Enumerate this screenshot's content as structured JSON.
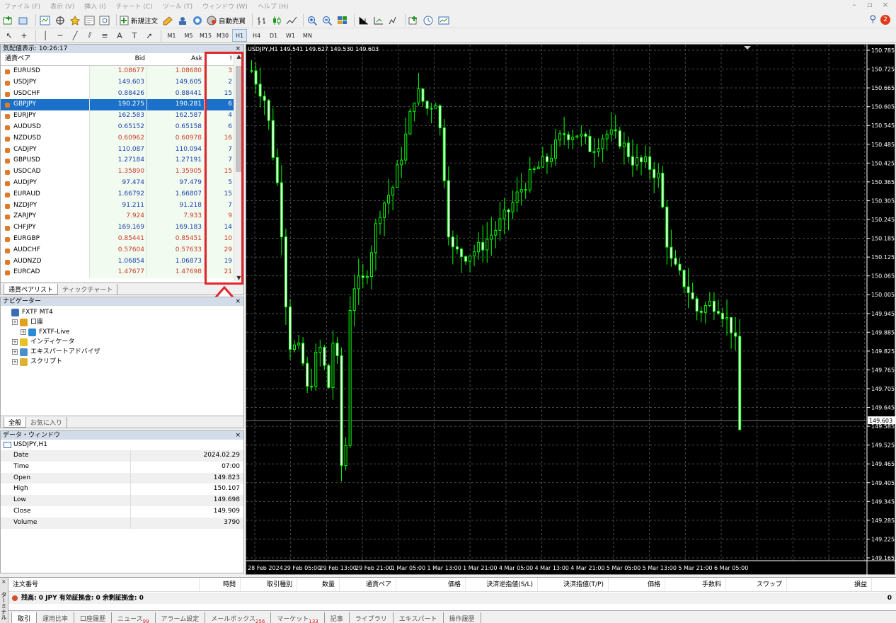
{
  "menu": [
    "ファイル (F)",
    "表示 (V)",
    "挿入 (I)",
    "チャート (C)",
    "ツール (T)",
    "ウィンドウ (W)",
    "ヘルプ (H)"
  ],
  "toolbar": {
    "new_order": "新規注文",
    "auto_trade": "自動売買",
    "notif_count": "2"
  },
  "timeframes": [
    "M1",
    "M5",
    "M15",
    "M30",
    "H1",
    "H4",
    "D1",
    "W1",
    "MN"
  ],
  "active_timeframe": "H1",
  "market_watch": {
    "title": "気配値表示: 10:26:17",
    "columns": [
      "通貨ペア",
      "Bid",
      "Ask",
      "!"
    ],
    "rows": [
      {
        "symbol": "EURUSD",
        "bid": "1.08677",
        "ask": "1.08680",
        "spread": "3",
        "color": "#d03a2a"
      },
      {
        "symbol": "USDJPY",
        "bid": "149.603",
        "ask": "149.605",
        "spread": "2",
        "color": "#1a3fb0"
      },
      {
        "symbol": "USDCHF",
        "bid": "0.88426",
        "ask": "0.88441",
        "spread": "15",
        "color": "#1a3fb0"
      },
      {
        "symbol": "GBPJPY",
        "bid": "190.275",
        "ask": "190.281",
        "spread": "6",
        "color": "#ffffff",
        "selected": true
      },
      {
        "symbol": "EURJPY",
        "bid": "162.583",
        "ask": "162.587",
        "spread": "4",
        "color": "#1a3fb0"
      },
      {
        "symbol": "AUDUSD",
        "bid": "0.65152",
        "ask": "0.65158",
        "spread": "6",
        "color": "#1a3fb0"
      },
      {
        "symbol": "NZDUSD",
        "bid": "0.60962",
        "ask": "0.60978",
        "spread": "16",
        "color": "#d03a2a"
      },
      {
        "symbol": "CADJPY",
        "bid": "110.087",
        "ask": "110.094",
        "spread": "7",
        "color": "#1a3fb0"
      },
      {
        "symbol": "GBPUSD",
        "bid": "1.27184",
        "ask": "1.27191",
        "spread": "7",
        "color": "#1a3fb0"
      },
      {
        "symbol": "USDCAD",
        "bid": "1.35890",
        "ask": "1.35905",
        "spread": "15",
        "color": "#d03a2a"
      },
      {
        "symbol": "AUDJPY",
        "bid": "97.474",
        "ask": "97.479",
        "spread": "5",
        "color": "#1a3fb0"
      },
      {
        "symbol": "EURAUD",
        "bid": "1.66792",
        "ask": "1.66807",
        "spread": "15",
        "color": "#1a3fb0"
      },
      {
        "symbol": "NZDJPY",
        "bid": "91.211",
        "ask": "91.218",
        "spread": "7",
        "color": "#1a3fb0"
      },
      {
        "symbol": "ZARJPY",
        "bid": "7.924",
        "ask": "7.933",
        "spread": "9",
        "color": "#d03a2a"
      },
      {
        "symbol": "CHFJPY",
        "bid": "169.169",
        "ask": "169.183",
        "spread": "14",
        "color": "#1a3fb0"
      },
      {
        "symbol": "EURGBP",
        "bid": "0.85441",
        "ask": "0.85451",
        "spread": "10",
        "color": "#d03a2a"
      },
      {
        "symbol": "AUDCHF",
        "bid": "0.57604",
        "ask": "0.57633",
        "spread": "29",
        "color": "#d03a2a"
      },
      {
        "symbol": "AUDNZD",
        "bid": "1.06854",
        "ask": "1.06873",
        "spread": "19",
        "color": "#1a3fb0"
      },
      {
        "symbol": "EURCAD",
        "bid": "1.47677",
        "ask": "1.47698",
        "spread": "21",
        "color": "#d03a2a"
      }
    ],
    "tabs": [
      "通貨ペアリスト",
      "ティックチャート"
    ]
  },
  "navigator": {
    "title": "ナビゲーター",
    "items": [
      {
        "label": "FXTF MT4",
        "indent": 0,
        "icon": "terminal-icon",
        "plus": false
      },
      {
        "label": "口座",
        "indent": 1,
        "icon": "accounts-icon",
        "plus": true
      },
      {
        "label": "FXTF-Live",
        "indent": 2,
        "icon": "account-server-icon",
        "plus": true
      },
      {
        "label": "インディケータ",
        "indent": 1,
        "icon": "indicators-icon",
        "plus": true
      },
      {
        "label": "エキスパートアドバイザ",
        "indent": 1,
        "icon": "expert-advisors-icon",
        "plus": true
      },
      {
        "label": "スクリプト",
        "indent": 1,
        "icon": "scripts-icon",
        "plus": true
      }
    ],
    "tabs": [
      "全般",
      "お気に入り"
    ]
  },
  "data_window": {
    "title": "データ・ウィンドウ",
    "symbol": "USDJPY,H1",
    "rows": [
      {
        "key": "Date",
        "value": "2024.02.29"
      },
      {
        "key": "Time",
        "value": "07:00"
      },
      {
        "key": "Open",
        "value": "149.823"
      },
      {
        "key": "High",
        "value": "150.107"
      },
      {
        "key": "Low",
        "value": "149.698"
      },
      {
        "key": "Close",
        "value": "149.909"
      },
      {
        "key": "Volume",
        "value": "3790"
      }
    ]
  },
  "chart": {
    "title": "USDJPY,H1  149.541 149.627 149.530 149.603",
    "price_labels": [
      "150.785",
      "150.725",
      "150.665",
      "150.605",
      "150.545",
      "150.485",
      "150.425",
      "150.365",
      "150.305",
      "150.245",
      "150.185",
      "150.125",
      "150.065",
      "150.005",
      "149.945",
      "149.885",
      "149.825",
      "149.765",
      "149.705",
      "149.645",
      "149.585",
      "149.525",
      "149.465",
      "149.405",
      "149.345",
      "149.285",
      "149.225",
      "149.165"
    ],
    "current_price": "149.603",
    "time_labels": [
      "28 Feb 2024",
      "29 Feb 05:00",
      "29 Feb 13:00",
      "29 Feb 21:00",
      "1 Mar 05:00",
      "1 Mar 13:00",
      "1 Mar 21:00",
      "4 Mar 05:00",
      "4 Mar 13:00",
      "4 Mar 21:00",
      "5 Mar 05:00",
      "5 Mar 13:00",
      "5 Mar 21:00",
      "6 Mar 05:00"
    ],
    "bull_color": "#00ff00",
    "bear_color": "#00ff00"
  },
  "terminal": {
    "side_label": "ターミナル",
    "columns": [
      "注文番号",
      "時間",
      "取引種別",
      "数量",
      "通貨ペア",
      "価格",
      "決済逆指値(S/L)",
      "決済指値(T/P)",
      "価格",
      "手数料",
      "スワップ",
      "損益"
    ],
    "balance": "残高: 0 JPY  有効証拠金: 0  余剰証拠金: 0",
    "balance_total": "0",
    "tabs": [
      {
        "label": "取引",
        "badge": ""
      },
      {
        "label": "運用比率",
        "badge": ""
      },
      {
        "label": "口座履歴",
        "badge": ""
      },
      {
        "label": "ニュース",
        "badge": "99"
      },
      {
        "label": "アラーム設定",
        "badge": ""
      },
      {
        "label": "メールボックス",
        "badge": "256"
      },
      {
        "label": "マーケット",
        "badge": "133"
      },
      {
        "label": "記事",
        "badge": ""
      },
      {
        "label": "ライブラリ",
        "badge": ""
      },
      {
        "label": "エキスパート",
        "badge": ""
      },
      {
        "label": "操作履歴",
        "badge": ""
      }
    ]
  }
}
